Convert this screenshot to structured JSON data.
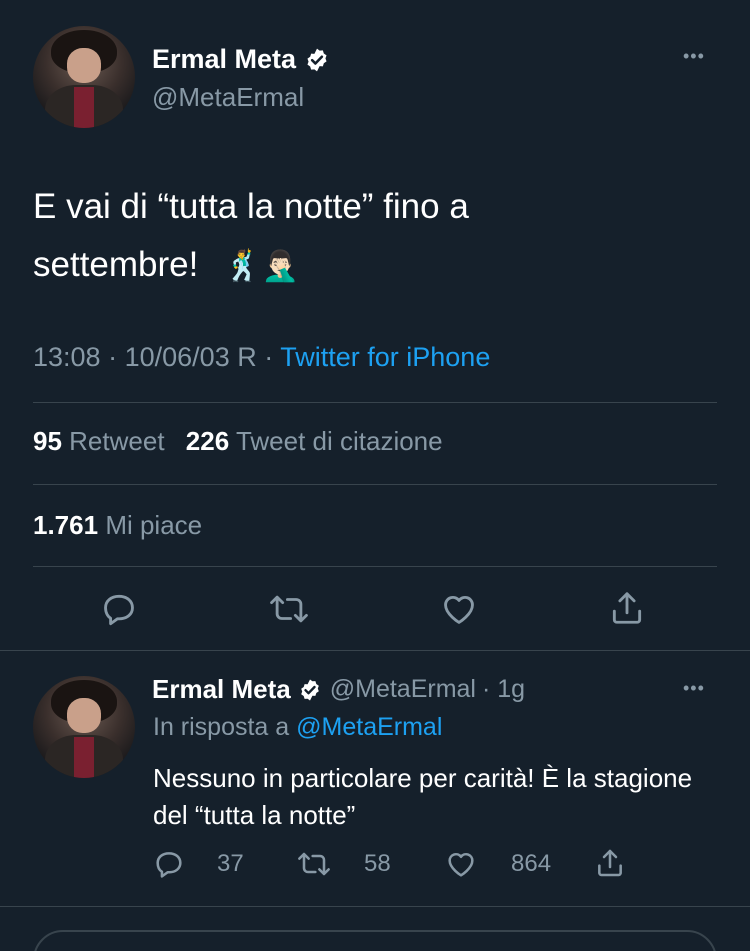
{
  "tweet": {
    "author_name": "Ermal Meta",
    "author_handle": "@MetaErmal",
    "text": "E vai di “tutta la notte” fino a settembre!",
    "emojis": "🕺🤦🏻‍♂️",
    "time": "13:08",
    "date": "10/06/03 R",
    "separator": "·",
    "source": "Twitter for iPhone",
    "retweets_count": "95",
    "retweets_label": "Retweet",
    "quotes_count": "226",
    "quotes_label": "Tweet di citazione",
    "likes_count": "1.761",
    "likes_label": "Mi piace",
    "more_label": "•••"
  },
  "reply": {
    "author_name": "Ermal Meta",
    "author_handle": "@MetaErmal",
    "age": "· 1g",
    "reply_to_prefix": "In risposta a",
    "reply_to_handle": "@MetaErmal",
    "text": "Nessuno in particolare per carità! È la stagione del “tutta la notte”",
    "reply_count": "37",
    "retweet_count": "58",
    "like_count": "864",
    "more_label": "•••"
  },
  "icons": {
    "verified": "verified-badge-icon",
    "reply": "reply-bubble-icon",
    "retweet": "retweet-icon",
    "like": "heart-icon",
    "share": "share-upload-icon"
  },
  "colors": {
    "background": "#15202b",
    "accent": "#1da1f2",
    "muted": "#8899a6",
    "divider": "#38444d"
  }
}
